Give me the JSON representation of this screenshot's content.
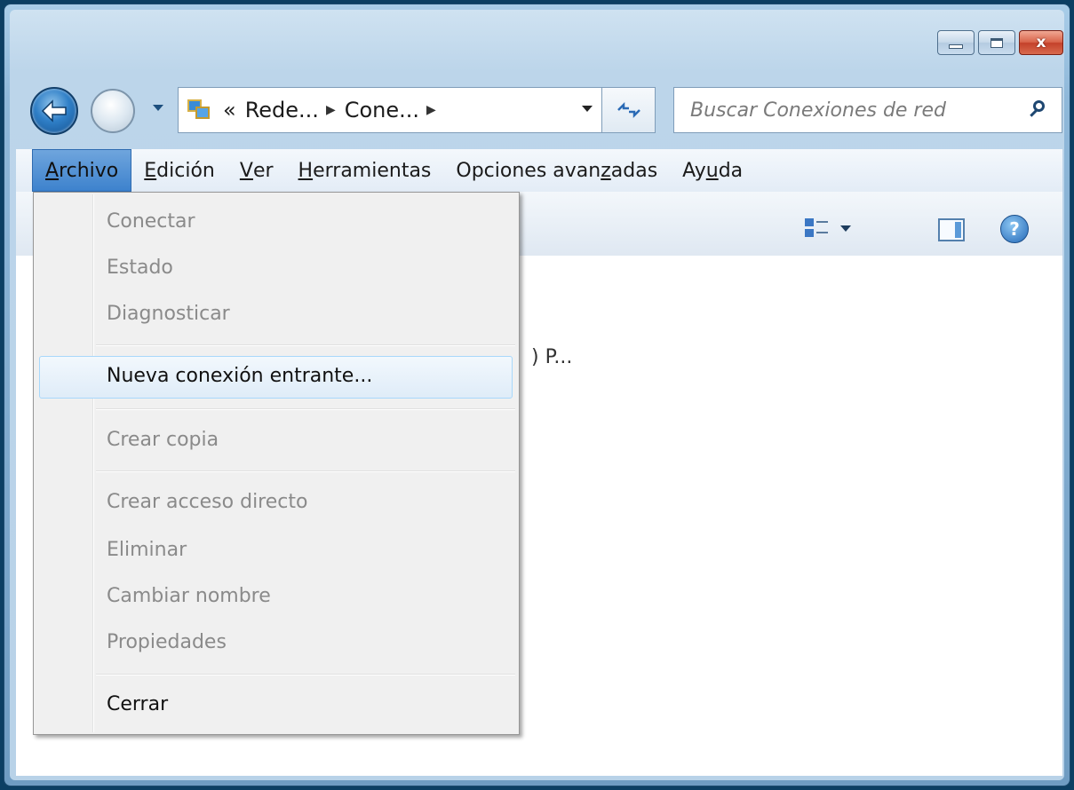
{
  "window": {
    "caption_buttons": {
      "minimize_icon": "minimize-icon",
      "maximize_icon": "maximize-icon",
      "close_label": "x"
    }
  },
  "navigation": {
    "breadcrumb": [
      "«",
      "Rede...",
      "Cone..."
    ],
    "search_placeholder": "Buscar Conexiones de red"
  },
  "menubar": {
    "items": [
      {
        "label": "Archivo",
        "accel": "A"
      },
      {
        "label": "Edición",
        "accel": "E"
      },
      {
        "label": "Ver",
        "accel": "V"
      },
      {
        "label": "Herramientas",
        "accel": "H"
      },
      {
        "label": "Opciones avanzadas",
        "accel": "z"
      },
      {
        "label": "Ayuda",
        "accel": "u"
      }
    ]
  },
  "toolbar": {
    "help_glyph": "?"
  },
  "content": {
    "partial_text": ") P..."
  },
  "file_menu": {
    "items": [
      {
        "label": "Conectar",
        "enabled": false
      },
      {
        "label": "Estado",
        "enabled": false
      },
      {
        "label": "Diagnosticar",
        "enabled": false
      },
      {
        "label": "Nueva conexión entrante...",
        "enabled": true,
        "highlighted": true
      },
      {
        "label": "Crear copia",
        "enabled": false
      },
      {
        "label": "Crear acceso directo",
        "enabled": false
      },
      {
        "label": "Eliminar",
        "enabled": false
      },
      {
        "label": "Cambiar nombre",
        "enabled": false
      },
      {
        "label": "Propiedades",
        "enabled": false
      },
      {
        "label": "Cerrar",
        "enabled": true
      }
    ]
  },
  "colors": {
    "menu_active_bg": "#3d82cd",
    "disabled_text": "#8a8a8a",
    "desktop_bg": "#0c3f63"
  }
}
